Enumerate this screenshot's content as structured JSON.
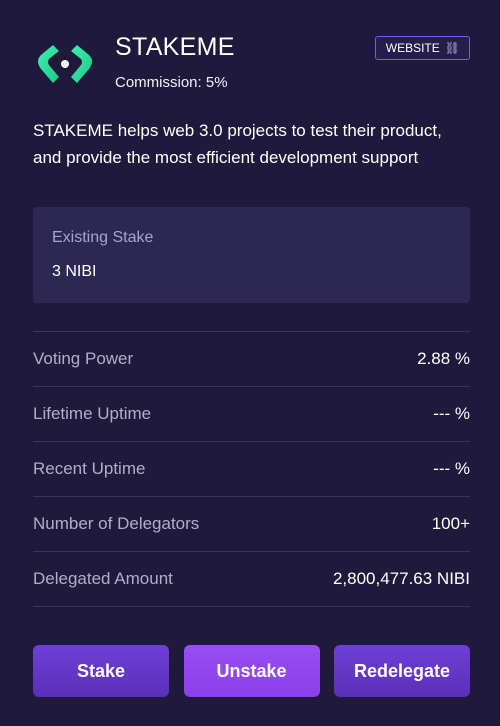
{
  "validator": {
    "name": "STAKEME",
    "commission": "Commission: 5%",
    "website_label": "WEBSITE",
    "description": "STAKEME helps web 3.0 projects to test their product, and provide the most efficient development support"
  },
  "existing_stake": {
    "label": "Existing Stake",
    "value": "3 NIBI"
  },
  "stats": [
    {
      "label": "Voting Power",
      "value": "2.88 %"
    },
    {
      "label": "Lifetime Uptime",
      "value": "--- %"
    },
    {
      "label": "Recent Uptime",
      "value": "--- %"
    },
    {
      "label": "Number of Delegators",
      "value": "100+"
    },
    {
      "label": "Delegated Amount",
      "value": "2,800,477.63 NIBI"
    }
  ],
  "actions": {
    "stake": "Stake",
    "unstake": "Unstake",
    "redelegate": "Redelegate"
  },
  "icons": {
    "logo": "stakeme-logo",
    "website_link": "link-icon"
  },
  "colors": {
    "background": "#1f1a3c",
    "accent": "#7a5cf0",
    "logo_green": "#22e8a0"
  }
}
